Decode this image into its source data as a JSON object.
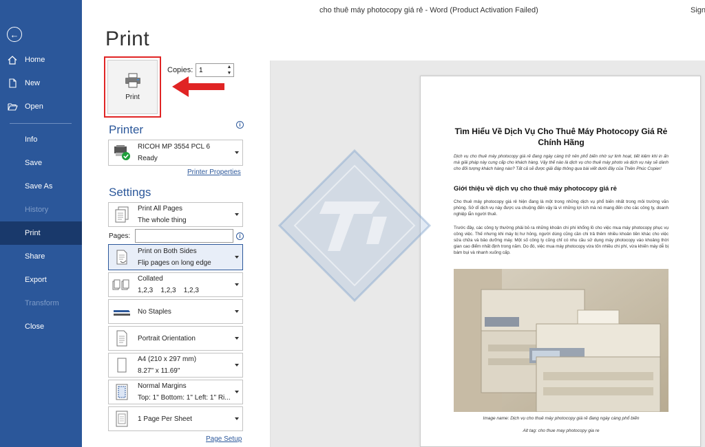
{
  "titlebar": {
    "title": "cho thuê máy photocopy giá rẻ  -  Word (Product Activation Failed)",
    "signin": "Sign"
  },
  "sidebar": {
    "items": [
      {
        "label": "Home",
        "icon": "home-icon"
      },
      {
        "label": "New",
        "icon": "new-document-icon"
      },
      {
        "label": "Open",
        "icon": "folder-open-icon"
      },
      {
        "label": "Info"
      },
      {
        "label": "Save"
      },
      {
        "label": "Save As"
      },
      {
        "label": "History",
        "disabled": true
      },
      {
        "label": "Print",
        "active": true
      },
      {
        "label": "Share"
      },
      {
        "label": "Export"
      },
      {
        "label": "Transform",
        "disabled": true
      },
      {
        "label": "Close"
      }
    ]
  },
  "print": {
    "heading": "Print",
    "button_label": "Print",
    "copies_label": "Copies:",
    "copies_value": "1"
  },
  "printer": {
    "section_title": "Printer",
    "name": "RICOH MP 3554 PCL 6",
    "status": "Ready",
    "properties_link": "Printer Properties"
  },
  "settings": {
    "section_title": "Settings",
    "pages_label": "Pages:",
    "pages_value": "",
    "options": [
      {
        "line1": "Print All Pages",
        "line2": "The whole thing"
      },
      {
        "line1": "Print on Both Sides",
        "line2": "Flip pages on long edge"
      },
      {
        "line1": "Collated",
        "line2": "1,2,3    1,2,3    1,2,3"
      },
      {
        "line1": "No Staples",
        "line2": ""
      },
      {
        "line1": "Portrait Orientation",
        "line2": ""
      },
      {
        "line1": "A4 (210 x 297 mm)",
        "line2": "8.27\" x 11.69\""
      },
      {
        "line1": "Normal Margins",
        "line2": "Top: 1\" Bottom: 1\" Left: 1\" Ri..."
      },
      {
        "line1": "1 Page Per Sheet",
        "line2": ""
      }
    ],
    "page_setup_link": "Page Setup"
  },
  "preview": {
    "title": "Tìm Hiểu Về Dịch Vụ Cho Thuê Máy Photocopy Giá Rẻ Chính Hãng",
    "intro": "Dịch vụ cho thuê máy photocopy giá rẻ đang ngày càng trở nên phổ biến nhờ sự linh hoạt, tiết kiệm khi in ấn mà giải pháp này cung cấp cho khách hàng. Vậy thế nào là dịch vụ cho thuê máy photo và dịch vụ này sẽ dành cho đối tượng khách hàng nào? Tất cả sẽ được giải đáp thông qua bài viết dưới đây của Thiên Phúc Copier!",
    "heading2": "Giới thiệu về dịch vụ cho thuê máy photocopy giá rẻ",
    "para1": "Cho thuê máy photocopy giá rẻ hiện đang là một trong những dịch vụ phổ biến nhất trong môi trường văn phòng. Sở dĩ dịch vụ này được ưa chuộng đến vậy là vì những lợi ích mà nó mang đến cho các công ty, doanh nghiệp lẫn người thuê.",
    "para2": "Trước đây, các công ty thường phải bỏ ra những khoản chi phí khổng lồ cho việc mua máy photocopy phục vụ công việc. Thế nhưng khi máy bị hư hỏng, người dùng cũng cần chi trả thêm nhiều khoản tiền khác cho việc sửa chữa và bảo dưỡng máy. Một số công ty cũng chỉ có nhu cầu sử dụng máy photocopy vào khoảng thời gian cao điểm nhất định trong năm. Do đó, việc mua máy photocopy vừa tốn nhiều chi phí, vừa khiến máy dễ bị bám bụi và nhanh xuống cấp.",
    "caption1": "Image name: Dịch vụ cho thuê máy photocopy giá rẻ đang ngày càng phổ biến",
    "caption2": "Alt tag: cho thue may photocopy gia re"
  },
  "colors": {
    "sidebar": "#2b579a",
    "sidebar_active": "#19396b",
    "accent": "#2b579a",
    "highlight": "#e02424"
  }
}
